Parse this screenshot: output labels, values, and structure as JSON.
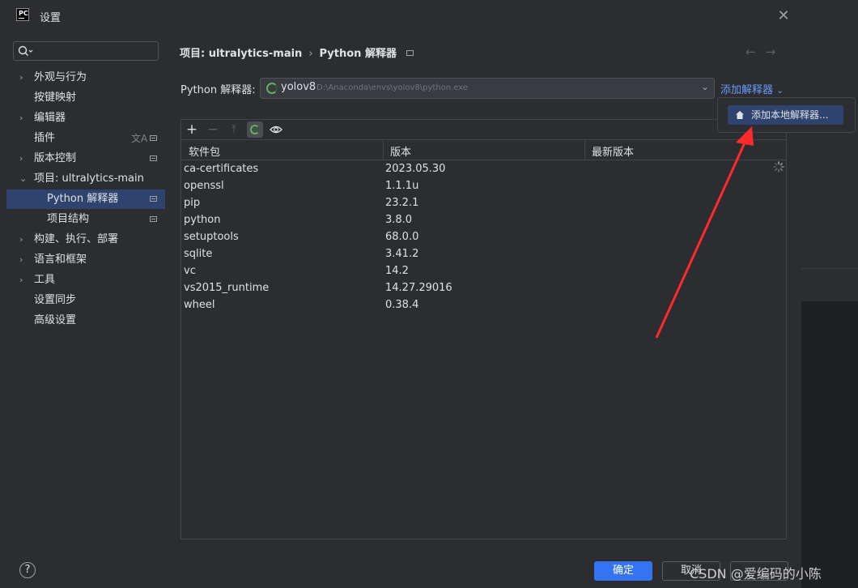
{
  "window": {
    "title": "设置",
    "app_icon_text": "PC"
  },
  "search": {
    "placeholder": ""
  },
  "sidebar": {
    "items": [
      {
        "label": "外观与行为",
        "expandable": true
      },
      {
        "label": "按键映射",
        "expandable": false
      },
      {
        "label": "编辑器",
        "expandable": true
      },
      {
        "label": "插件",
        "expandable": false
      },
      {
        "label": "版本控制",
        "expandable": true
      },
      {
        "label": "项目: ultralytics-main",
        "expandable": true,
        "expanded": true
      },
      {
        "label": "Python 解释器",
        "child": true,
        "selected": true
      },
      {
        "label": "项目结构",
        "child": true
      },
      {
        "label": "构建、执行、部署",
        "expandable": true
      },
      {
        "label": "语言和框架",
        "expandable": true
      },
      {
        "label": "工具",
        "expandable": true
      },
      {
        "label": "设置同步",
        "expandable": false
      },
      {
        "label": "高级设置",
        "expandable": false
      }
    ]
  },
  "breadcrumb": {
    "project": "项目: ultralytics-main",
    "separator": "›",
    "page": "Python 解释器"
  },
  "interpreter": {
    "label": "Python 解释器:",
    "name": "yolov8",
    "path": "D:\\Anaconda\\envs\\yolov8\\python.exe",
    "add_label": "添加解释器"
  },
  "popup": {
    "item_label": "添加本地解释器..."
  },
  "table": {
    "columns": [
      "软件包",
      "版本",
      "最新版本"
    ],
    "rows": [
      {
        "package": "ca-certificates",
        "version": "2023.05.30",
        "latest": ""
      },
      {
        "package": "openssl",
        "version": "1.1.1u",
        "latest": ""
      },
      {
        "package": "pip",
        "version": "23.2.1",
        "latest": ""
      },
      {
        "package": "python",
        "version": "3.8.0",
        "latest": ""
      },
      {
        "package": "setuptools",
        "version": "68.0.0",
        "latest": ""
      },
      {
        "package": "sqlite",
        "version": "3.41.2",
        "latest": ""
      },
      {
        "package": "vc",
        "version": "14.2",
        "latest": ""
      },
      {
        "package": "vs2015_runtime",
        "version": "14.27.29016",
        "latest": ""
      },
      {
        "package": "wheel",
        "version": "0.38.4",
        "latest": ""
      }
    ]
  },
  "footer": {
    "help": "?",
    "ok": "确定",
    "cancel": "取消"
  },
  "watermark": "CSDN @爱编码的小陈",
  "colors": {
    "accent": "#3574f0",
    "selection": "#2e436e",
    "link": "#6b9bfa",
    "annotation_arrow": "#ff2a2a"
  }
}
